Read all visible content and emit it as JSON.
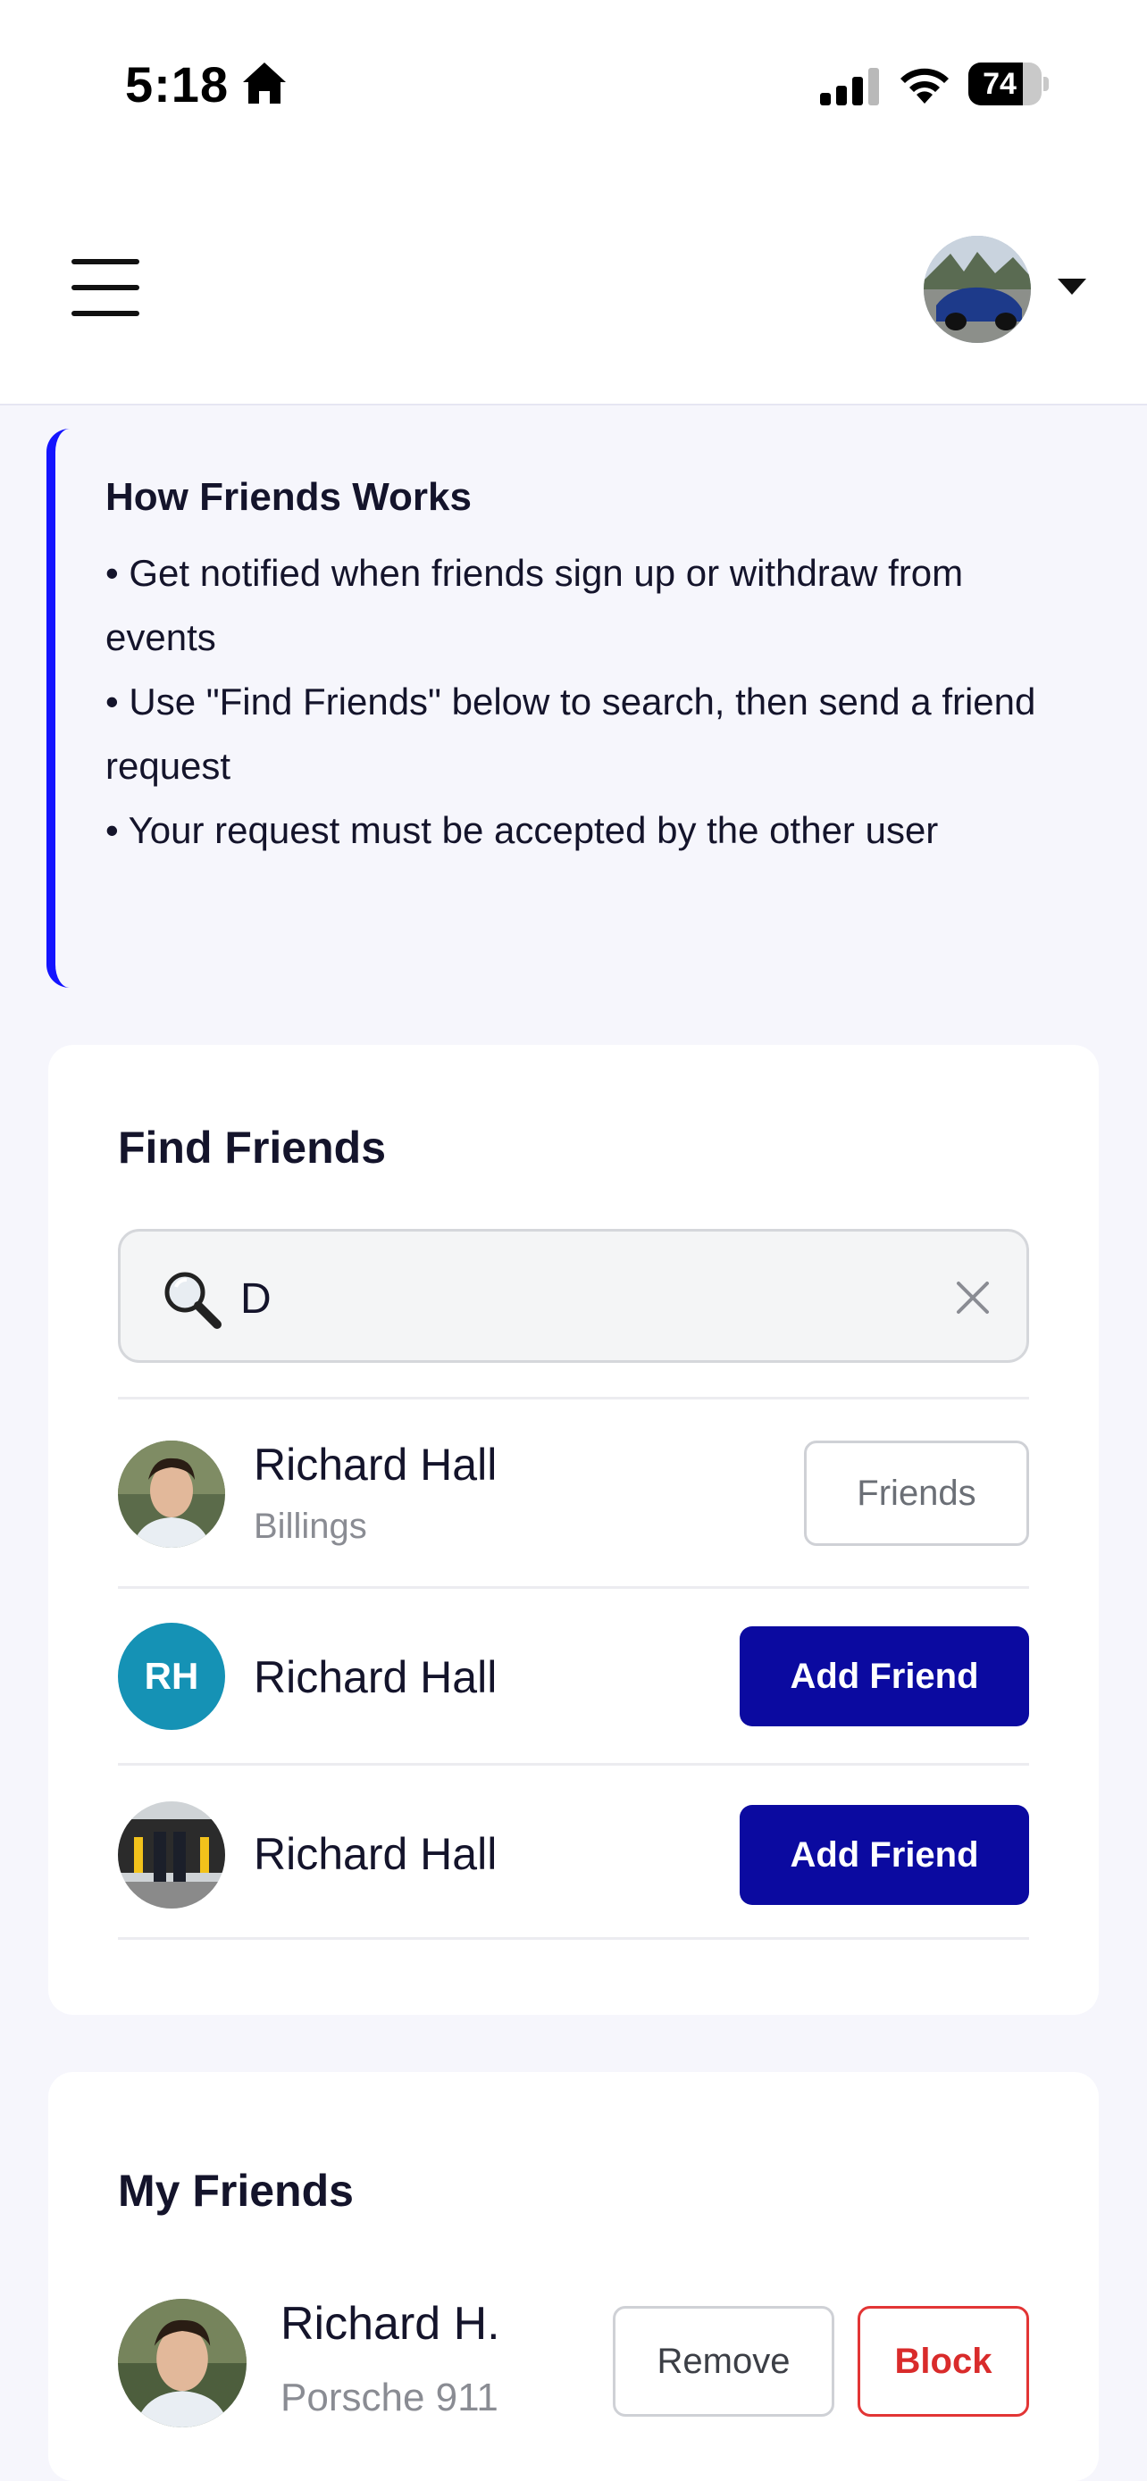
{
  "status_bar": {
    "time": "5:18",
    "battery": "74",
    "battery_level": 0.74
  },
  "info": {
    "title": "How Friends Works",
    "lines": [
      "• Get notified when friends sign up or withdraw from events",
      "• Use \"Find Friends\" below to search, then send a friend request",
      "• Your request must be accepted by the other user"
    ]
  },
  "find_friends": {
    "title": "Find Friends",
    "search_value": "D",
    "results": [
      {
        "name": "Richard Hall",
        "location": "Billings",
        "action": "Friends"
      },
      {
        "name": "Richard Hall",
        "initials": "RH",
        "action": "Add Friend"
      },
      {
        "name": "Richard Hall",
        "action": "Add Friend"
      }
    ]
  },
  "my_friends": {
    "title": "My Friends",
    "items": [
      {
        "name": "Richard H.",
        "car": "Porsche 911",
        "remove_label": "Remove",
        "block_label": "Block"
      }
    ]
  },
  "colors": {
    "accent": "#1414ff",
    "primary_button": "#0b0aa0",
    "initials_bg": "#1592b5",
    "block_red": "#d92b2b"
  }
}
